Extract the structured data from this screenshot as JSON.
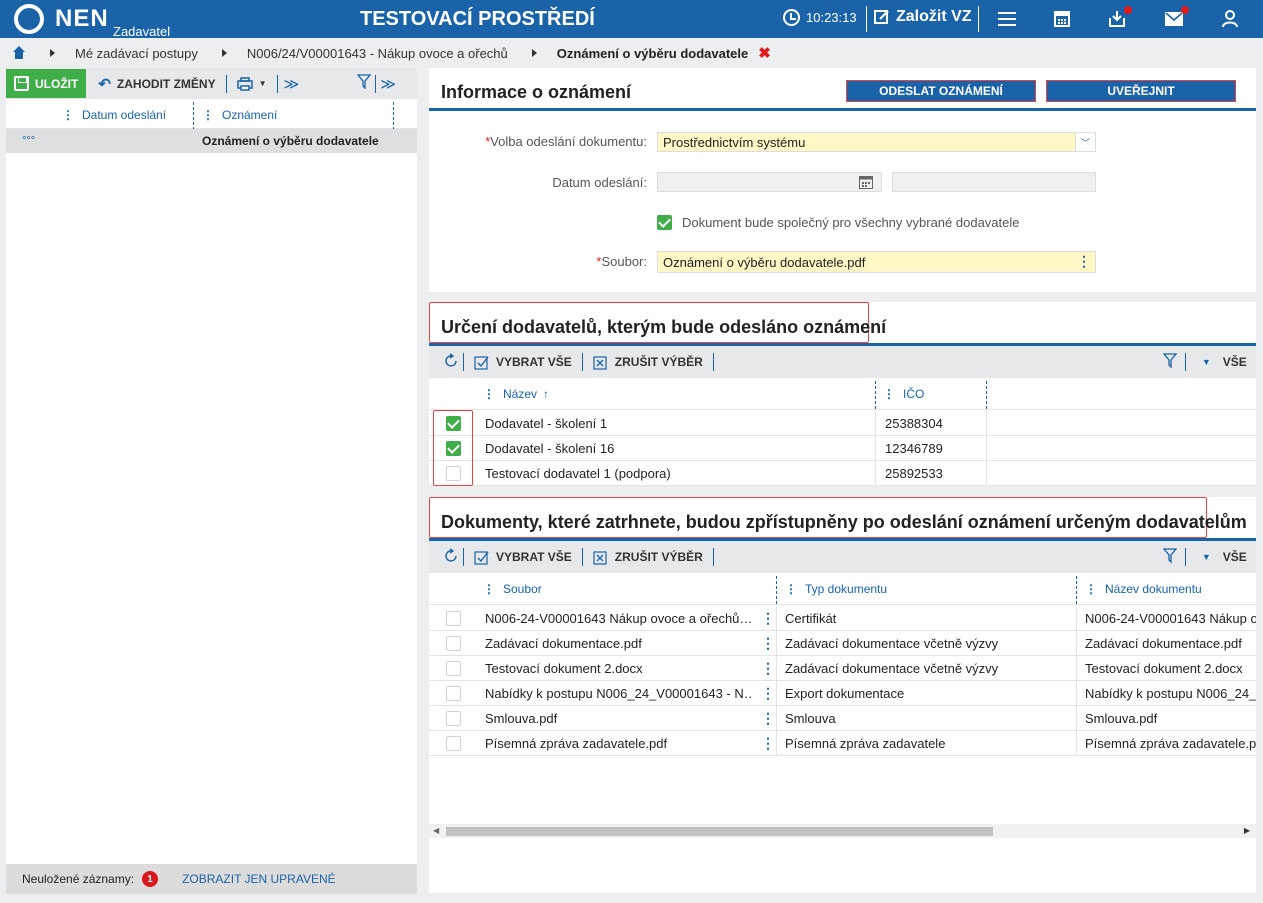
{
  "header": {
    "brand": "NEN",
    "brand_sub": "Zadavatel",
    "env_title": "TESTOVACÍ PROSTŘEDÍ",
    "time": "10:23:13",
    "new_vz": "Založit VZ"
  },
  "breadcrumb": {
    "items": [
      "Mé zadávací postupy",
      "N006/24/V00001643 - Nákup ovoce a ořechů"
    ],
    "current": "Oznámení o výběru dodavatele",
    "close": "✖"
  },
  "left": {
    "toolbar": {
      "save": "ULOŽIT",
      "discard": "ZAHODIT ZMĚNY"
    },
    "columns": [
      "Datum odeslání",
      "Oznámení"
    ],
    "row": {
      "dots": "°°°",
      "datum": "",
      "oznameni": "Oznámení o výběru dodavatele"
    },
    "footer": {
      "label": "Neuložené záznamy:",
      "count": "1",
      "link": "ZOBRAZIT JEN UPRAVENÉ"
    }
  },
  "info": {
    "title": "Informace o oznámení",
    "btn_send": "ODESLAT OZNÁMENÍ",
    "btn_publish": "UVEŘEJNIT",
    "volba_label": "Volba odeslání dokumentu:",
    "volba_value": "Prostřednictvím systému",
    "datum_label": "Datum odeslání:",
    "datum_value": "",
    "shared_label": "Dokument bude společný pro všechny vybrané dodavatele",
    "soubor_label": "Soubor:",
    "soubor_value": "Oznámení o výběru dodavatele.pdf"
  },
  "suppliers": {
    "title": "Určení dodavatelů, kterým bude odesláno oznámení",
    "toolbar": {
      "select_all": "VYBRAT VŠE",
      "clear": "ZRUŠIT VÝBĚR",
      "filter_all": "VŠE"
    },
    "columns": {
      "name": "Název",
      "ico": "IČO"
    },
    "rows": [
      {
        "checked": true,
        "name": "Dodavatel - školení 1",
        "ico": "25388304"
      },
      {
        "checked": true,
        "name": "Dodavatel - školení 16",
        "ico": "12346789"
      },
      {
        "checked": false,
        "name": "Testovací dodavatel 1 (podpora)",
        "ico": "25892533"
      }
    ]
  },
  "documents": {
    "title": "Dokumenty, které zatrhnete, budou zpřístupněny po odeslání oznámení určeným dodavatelům",
    "toolbar": {
      "select_all": "VYBRAT VŠE",
      "clear": "ZRUŠIT VÝBĚR",
      "filter_all": "VŠE"
    },
    "columns": {
      "file": "Soubor",
      "type": "Typ dokumentu",
      "name": "Název dokumentu"
    },
    "rows": [
      {
        "checked": false,
        "file": "N006-24-V00001643 Nákup ovoce a ořechů…",
        "type": "Certifikát",
        "name": "N006-24-V00001643 Nákup o"
      },
      {
        "checked": false,
        "file": "Zadávací dokumentace.pdf",
        "type": "Zadávací dokumentace včetně výzvy",
        "name": "Zadávací dokumentace.pdf"
      },
      {
        "checked": false,
        "file": "Testovací dokument 2.docx",
        "type": "Zadávací dokumentace včetně výzvy",
        "name": "Testovací dokument 2.docx"
      },
      {
        "checked": false,
        "file": "Nabídky k postupu N006_24_V00001643 - N…",
        "type": "Export dokumentace",
        "name": "Nabídky k postupu N006_24_V"
      },
      {
        "checked": false,
        "file": "Smlouva.pdf",
        "type": "Smlouva",
        "name": "Smlouva.pdf"
      },
      {
        "checked": false,
        "file": "Písemná zpráva zadavatele.pdf",
        "type": "Písemná zpráva zadavatele",
        "name": "Písemná zpráva zadavatele.p"
      }
    ]
  },
  "icons": {
    "menu": "menu-icon",
    "calculator": "calculator-icon",
    "inbox": "inbox-icon",
    "mail": "mail-icon",
    "user": "user-icon"
  },
  "colors": {
    "primary": "#1a63a8",
    "success": "#3fae49",
    "danger": "#e01c1c",
    "highlight": "#fff8c6"
  }
}
